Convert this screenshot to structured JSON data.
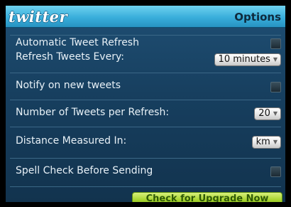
{
  "header": {
    "logo_text": "twitter",
    "title": "Options"
  },
  "settings": {
    "auto_refresh_label": "Automatic Tweet Refresh",
    "refresh_every_label": "Refresh Tweets Every:",
    "refresh_every_value": "10 minutes",
    "notify_label": "Notify on new tweets",
    "tweets_per_refresh_label": "Number of Tweets per Refresh:",
    "tweets_per_refresh_value": "20",
    "distance_label": "Distance Measured In:",
    "distance_value": "km",
    "spell_check_label": "Spell Check Before Sending"
  },
  "upgrade_button": "Check for Upgrade Now",
  "icons": {
    "dropdown": "chevron-down-icon"
  },
  "colors": {
    "header": "#39aedb",
    "background": "#173f5f",
    "upgrade_button": "#a8d530"
  }
}
